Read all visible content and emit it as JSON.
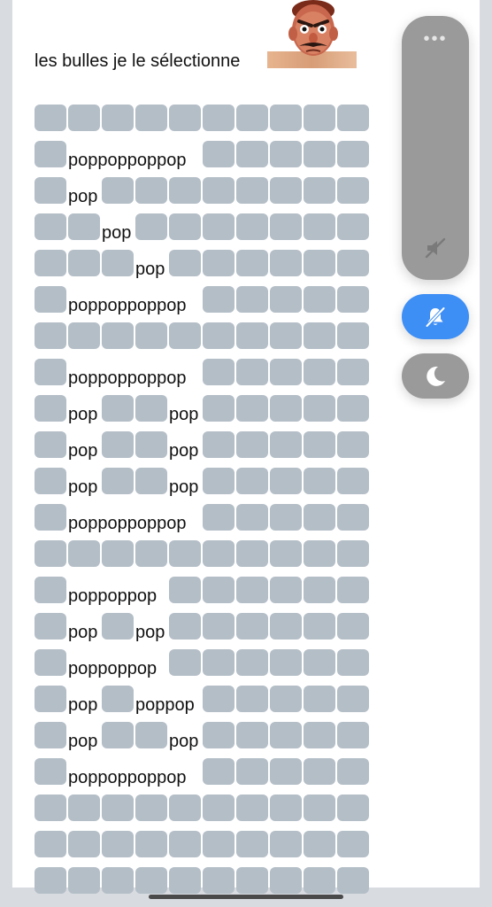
{
  "message": {
    "text": "les bulles je le sélectionne"
  },
  "bubble_grid": {
    "rows": [
      [
        "t",
        "t",
        "t",
        "t",
        "t",
        "t",
        "t",
        "t",
        "t",
        "t"
      ],
      [
        "t",
        "poppoppoppop",
        "t",
        "t",
        "t",
        "t",
        "t"
      ],
      [
        "t",
        "pop",
        "t",
        "t",
        "t",
        "t",
        "t",
        "t",
        "t",
        "t"
      ],
      [
        "t",
        "t",
        "pop",
        "t",
        "t",
        "t",
        "t",
        "t",
        "t",
        "t"
      ],
      [
        "t",
        "t",
        "t",
        "pop",
        "t",
        "t",
        "t",
        "t",
        "t",
        "t"
      ],
      [
        "t",
        "poppoppoppop",
        "t",
        "t",
        "t",
        "t",
        "t"
      ],
      [
        "t",
        "t",
        "t",
        "t",
        "t",
        "t",
        "t",
        "t",
        "t",
        "t"
      ],
      [
        "t",
        "poppoppoppop",
        "t",
        "t",
        "t",
        "t",
        "t"
      ],
      [
        "t",
        "pop",
        "t",
        "t",
        "pop",
        "t",
        "t",
        "t",
        "t",
        "t"
      ],
      [
        "t",
        "pop",
        "t",
        "t",
        "pop",
        "t",
        "t",
        "t",
        "t",
        "t"
      ],
      [
        "t",
        "pop",
        "t",
        "t",
        "pop",
        "t",
        "t",
        "t",
        "t",
        "t"
      ],
      [
        "t",
        "poppoppoppop",
        "t",
        "t",
        "t",
        "t",
        "t"
      ],
      [
        "t",
        "t",
        "t",
        "t",
        "t",
        "t",
        "t",
        "t",
        "t",
        "t"
      ],
      [
        "t",
        "poppoppop",
        "t",
        "t",
        "t",
        "t",
        "t",
        "t"
      ],
      [
        "t",
        "pop",
        "t",
        "pop",
        "t",
        "t",
        "t",
        "t",
        "t",
        "t"
      ],
      [
        "t",
        "poppoppop",
        "t",
        "t",
        "t",
        "t",
        "t",
        "t"
      ],
      [
        "t",
        "pop",
        "t",
        "poppop",
        "t",
        "t",
        "t",
        "t",
        "t"
      ],
      [
        "t",
        "pop",
        "t",
        "t",
        "pop",
        "t",
        "t",
        "t",
        "t",
        "t"
      ],
      [
        "t",
        "poppoppoppop",
        "t",
        "t",
        "t",
        "t",
        "t"
      ],
      [
        "t",
        "t",
        "t",
        "t",
        "t",
        "t",
        "t",
        "t",
        "t",
        "t"
      ],
      [
        "t",
        "t",
        "t",
        "t",
        "t",
        "t",
        "t",
        "t",
        "t",
        "t"
      ],
      [
        "t",
        "t",
        "t",
        "t",
        "t",
        "t",
        "t",
        "t",
        "t",
        "t"
      ]
    ]
  },
  "side_controls": {
    "menu_glyph": "•••",
    "icons": [
      "speaker-muted-icon",
      "bell-off-icon",
      "moon-icon"
    ],
    "colors": {
      "panel": "#9a9a9a",
      "active_button": "#3d8ef5",
      "tile": "#b4bec7"
    }
  }
}
